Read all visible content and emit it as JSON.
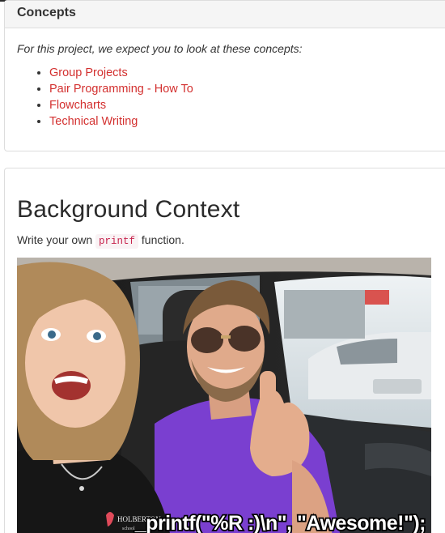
{
  "concepts": {
    "heading": "Concepts",
    "intro": "For this project, we expect you to look at these concepts:",
    "items": [
      {
        "label": "Group Projects"
      },
      {
        "label": "Pair Programming - How To"
      },
      {
        "label": "Flowcharts"
      },
      {
        "label": "Technical Writing"
      }
    ]
  },
  "background": {
    "heading": "Background Context",
    "desc_before": "Write your own",
    "code": "printf",
    "desc_after": "function.",
    "image": {
      "caption": "_printf(\"%R :)\\n\", \"Awesome!\");",
      "shirt_text": "HOLBERTON",
      "shirt_subtext": "school"
    }
  },
  "colors": {
    "link": "#d3302f",
    "code": "#c7254e",
    "code_bg": "#f9f2f4",
    "shirt_purple": "#7a3fd0"
  }
}
